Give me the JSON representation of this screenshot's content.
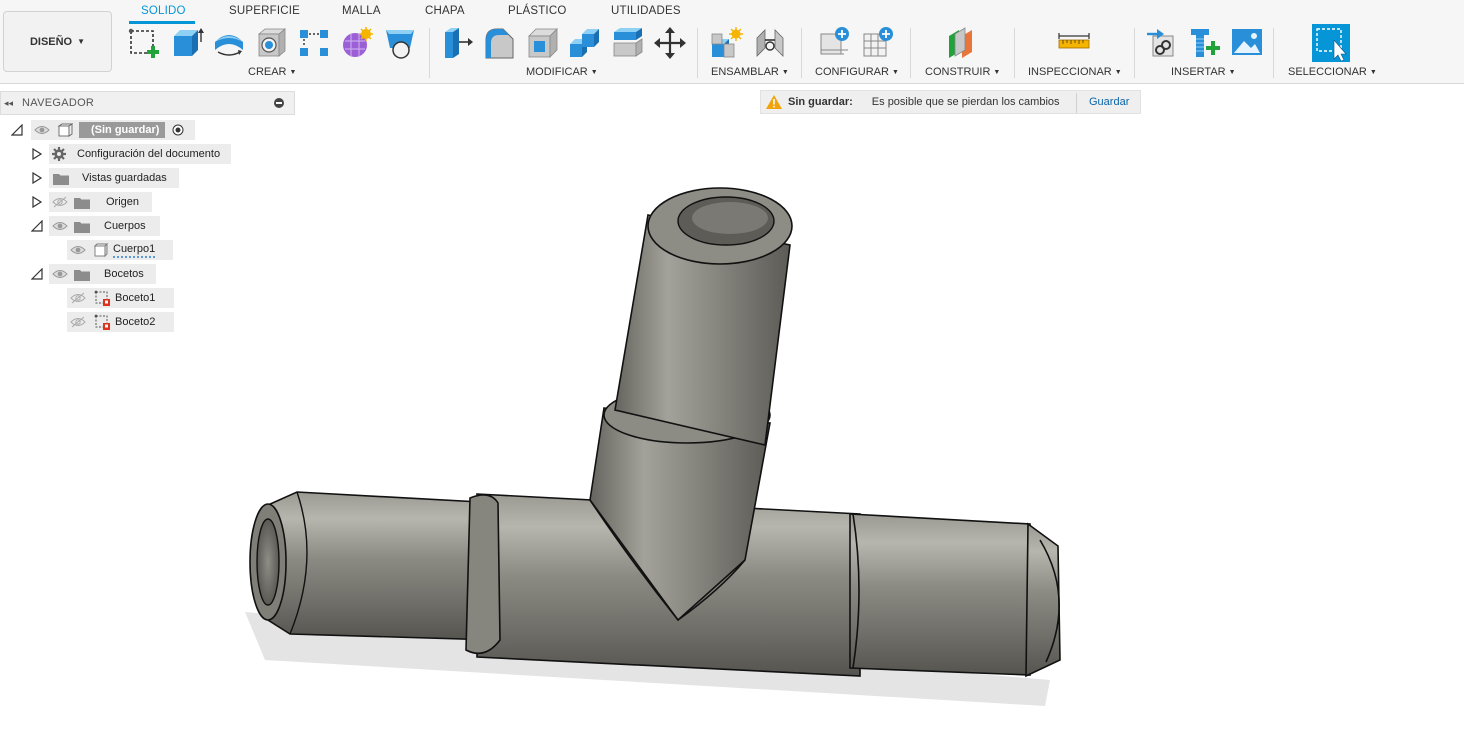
{
  "workspace": {
    "label": "DISEÑO"
  },
  "tabs": [
    {
      "label": "SOLIDO",
      "active": true
    },
    {
      "label": "SUPERFICIE",
      "active": false
    },
    {
      "label": "MALLA",
      "active": false
    },
    {
      "label": "CHAPA",
      "active": false
    },
    {
      "label": "PLÁSTICO",
      "active": false
    },
    {
      "label": "UTILIDADES",
      "active": false
    }
  ],
  "groups": {
    "crear": "CREAR",
    "modificar": "MODIFICAR",
    "ensamblar": "ENSAMBLAR",
    "configurar": "CONFIGURAR",
    "construir": "CONSTRUIR",
    "inspeccionar": "INSPECCIONAR",
    "insertar": "INSERTAR",
    "seleccionar": "SELECCIONAR"
  },
  "icons": {
    "create": [
      "create-sketch-icon",
      "extrude-icon",
      "revolve-icon",
      "hole-icon",
      "rectangular-pattern-icon",
      "create-form-icon",
      "loft-icon"
    ],
    "modify": [
      "press-pull-icon",
      "fillet-icon",
      "shell-icon",
      "combine-icon",
      "offset-face-icon",
      "move-copy-icon"
    ],
    "assemble": [
      "new-component-icon",
      "joint-icon"
    ],
    "configure": [
      "configure-model-icon",
      "configuration-table-icon"
    ],
    "construct": "offset-plane-icon",
    "inspect": "measure-icon",
    "insert": [
      "insert-derive-icon",
      "insert-mcmaster-icon",
      "insert-canvas-icon"
    ],
    "select": "window-select-icon"
  },
  "navigator": {
    "title": "NAVEGADOR",
    "root": "(Sin guardar)",
    "doc_settings": "Configuración del documento",
    "saved_views": "Vistas guardadas",
    "origin": "Origen",
    "bodies": "Cuerpos",
    "body1": "Cuerpo1",
    "sketches": "Bocetos",
    "sketch1": "Boceto1",
    "sketch2": "Boceto2"
  },
  "banner": {
    "label": "Sin guardar:",
    "message": "Es posible que se pierdan los cambios",
    "action": "Guardar"
  },
  "colors": {
    "accent": "#0696d7",
    "model_body": "#7b7a73",
    "warning": "#f0a30a",
    "link": "#0a64a8"
  }
}
